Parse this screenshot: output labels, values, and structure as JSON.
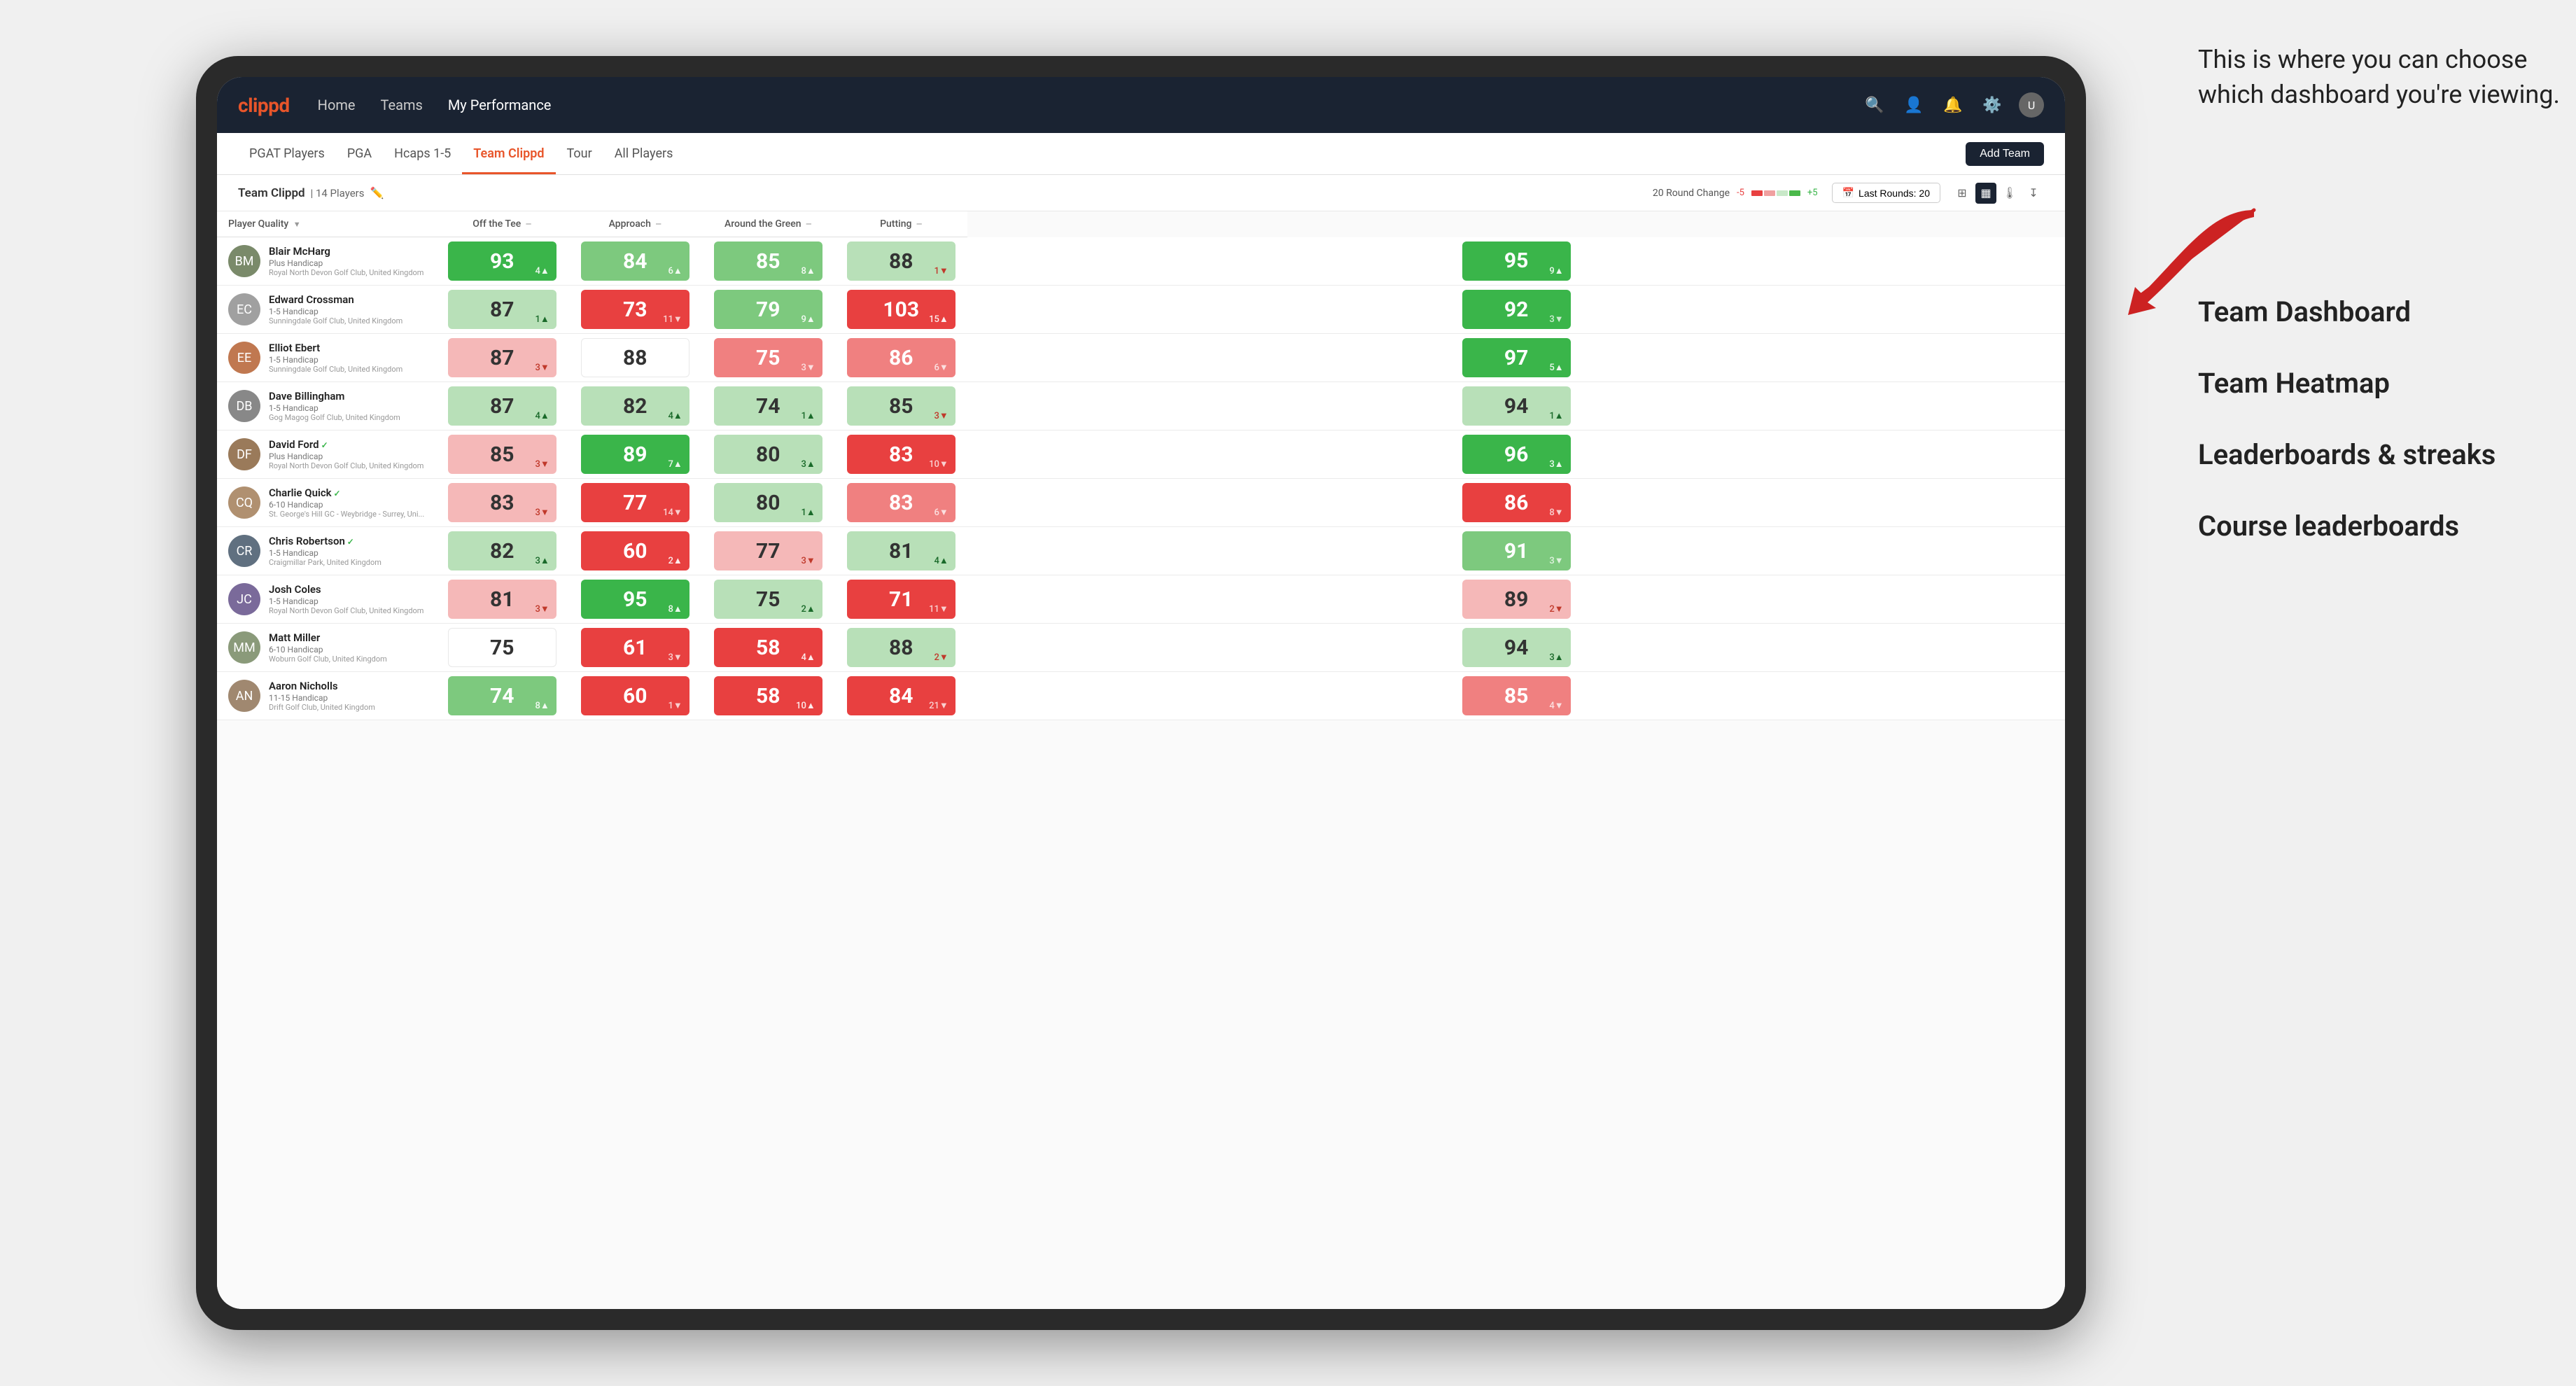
{
  "annotation": {
    "intro_text": "This is where you can choose which dashboard you're viewing.",
    "items": [
      "Team Dashboard",
      "Team Heatmap",
      "Leaderboards & streaks",
      "Course leaderboards"
    ]
  },
  "nav": {
    "logo": "clippd",
    "links": [
      "Home",
      "Teams",
      "My Performance"
    ],
    "active_link": "My Performance"
  },
  "tabs": {
    "items": [
      "PGAT Players",
      "PGA",
      "Hcaps 1-5",
      "Team Clippd",
      "Tour",
      "All Players"
    ],
    "active": "Team Clippd",
    "add_button": "Add Team"
  },
  "sub_header": {
    "team_name": "Team Clippd",
    "separator": "|",
    "player_count": "14 Players",
    "round_change_label": "20 Round Change",
    "change_neg": "-5",
    "change_pos": "+5",
    "last_rounds_label": "Last Rounds:",
    "last_rounds_val": "20"
  },
  "table": {
    "columns": [
      {
        "id": "player",
        "label": "Player Quality",
        "sort": true
      },
      {
        "id": "off_tee",
        "label": "Off the Tee",
        "sort": false
      },
      {
        "id": "approach",
        "label": "Approach",
        "sort": false
      },
      {
        "id": "around_green",
        "label": "Around the Green",
        "sort": false
      },
      {
        "id": "putting",
        "label": "Putting",
        "sort": false
      }
    ],
    "rows": [
      {
        "name": "Blair McHarg",
        "handicap": "Plus Handicap",
        "club": "Royal North Devon Golf Club, United Kingdom",
        "avatar_color": "#7a8a6a",
        "avatar_initials": "BM",
        "player_quality": {
          "val": 93,
          "change": 4,
          "dir": "up",
          "bg": "bg-green-dark"
        },
        "off_tee": {
          "val": 84,
          "change": 6,
          "dir": "up",
          "bg": "bg-green-med"
        },
        "approach": {
          "val": 85,
          "change": 8,
          "dir": "up",
          "bg": "bg-green-med"
        },
        "around_green": {
          "val": 88,
          "change": 1,
          "dir": "down",
          "bg": "bg-green-light"
        },
        "putting": {
          "val": 95,
          "change": 9,
          "dir": "up",
          "bg": "bg-green-dark"
        }
      },
      {
        "name": "Edward Crossman",
        "handicap": "1-5 Handicap",
        "club": "Sunningdale Golf Club, United Kingdom",
        "avatar_color": "#a0a0a0",
        "avatar_initials": "EC",
        "player_quality": {
          "val": 87,
          "change": 1,
          "dir": "up",
          "bg": "bg-green-light"
        },
        "off_tee": {
          "val": 73,
          "change": 11,
          "dir": "down",
          "bg": "bg-red-dark"
        },
        "approach": {
          "val": 79,
          "change": 9,
          "dir": "up",
          "bg": "bg-green-med"
        },
        "around_green": {
          "val": 103,
          "change": 15,
          "dir": "up",
          "bg": "bg-red-dark"
        },
        "putting": {
          "val": 92,
          "change": 3,
          "dir": "down",
          "bg": "bg-green-dark"
        }
      },
      {
        "name": "Elliot Ebert",
        "handicap": "1-5 Handicap",
        "club": "Sunningdale Golf Club, United Kingdom",
        "avatar_color": "#c07850",
        "avatar_initials": "EE",
        "player_quality": {
          "val": 87,
          "change": 3,
          "dir": "down",
          "bg": "bg-red-light"
        },
        "off_tee": {
          "val": 88,
          "change": 0,
          "dir": "neutral",
          "bg": "bg-white"
        },
        "approach": {
          "val": 75,
          "change": 3,
          "dir": "down",
          "bg": "bg-red-med"
        },
        "around_green": {
          "val": 86,
          "change": 6,
          "dir": "down",
          "bg": "bg-red-med"
        },
        "putting": {
          "val": 97,
          "change": 5,
          "dir": "up",
          "bg": "bg-green-dark"
        }
      },
      {
        "name": "Dave Billingham",
        "handicap": "1-5 Handicap",
        "club": "Gog Magog Golf Club, United Kingdom",
        "avatar_color": "#888",
        "avatar_initials": "DB",
        "player_quality": {
          "val": 87,
          "change": 4,
          "dir": "up",
          "bg": "bg-green-light"
        },
        "off_tee": {
          "val": 82,
          "change": 4,
          "dir": "up",
          "bg": "bg-green-light"
        },
        "approach": {
          "val": 74,
          "change": 1,
          "dir": "up",
          "bg": "bg-green-light"
        },
        "around_green": {
          "val": 85,
          "change": 3,
          "dir": "down",
          "bg": "bg-green-light"
        },
        "putting": {
          "val": 94,
          "change": 1,
          "dir": "up",
          "bg": "bg-green-light"
        }
      },
      {
        "name": "David Ford",
        "handicap": "Plus Handicap",
        "club": "Royal North Devon Golf Club, United Kingdom",
        "avatar_color": "#9a7a5a",
        "avatar_initials": "DF",
        "verified": true,
        "player_quality": {
          "val": 85,
          "change": 3,
          "dir": "down",
          "bg": "bg-red-light"
        },
        "off_tee": {
          "val": 89,
          "change": 7,
          "dir": "up",
          "bg": "bg-green-dark"
        },
        "approach": {
          "val": 80,
          "change": 3,
          "dir": "up",
          "bg": "bg-green-light"
        },
        "around_green": {
          "val": 83,
          "change": 10,
          "dir": "down",
          "bg": "bg-red-dark"
        },
        "putting": {
          "val": 96,
          "change": 3,
          "dir": "up",
          "bg": "bg-green-dark"
        }
      },
      {
        "name": "Charlie Quick",
        "handicap": "6-10 Handicap",
        "club": "St. George's Hill GC - Weybridge - Surrey, Uni...",
        "avatar_color": "#b09070",
        "avatar_initials": "CQ",
        "verified": true,
        "player_quality": {
          "val": 83,
          "change": 3,
          "dir": "down",
          "bg": "bg-red-light"
        },
        "off_tee": {
          "val": 77,
          "change": 14,
          "dir": "down",
          "bg": "bg-red-dark"
        },
        "approach": {
          "val": 80,
          "change": 1,
          "dir": "up",
          "bg": "bg-green-light"
        },
        "around_green": {
          "val": 83,
          "change": 6,
          "dir": "down",
          "bg": "bg-red-med"
        },
        "putting": {
          "val": 86,
          "change": 8,
          "dir": "down",
          "bg": "bg-red-dark"
        }
      },
      {
        "name": "Chris Robertson",
        "handicap": "1-5 Handicap",
        "club": "Craigmillar Park, United Kingdom",
        "avatar_color": "#607080",
        "avatar_initials": "CR",
        "verified": true,
        "player_quality": {
          "val": 82,
          "change": 3,
          "dir": "up",
          "bg": "bg-green-light"
        },
        "off_tee": {
          "val": 60,
          "change": 2,
          "dir": "up",
          "bg": "bg-red-dark"
        },
        "approach": {
          "val": 77,
          "change": 3,
          "dir": "down",
          "bg": "bg-red-light"
        },
        "around_green": {
          "val": 81,
          "change": 4,
          "dir": "up",
          "bg": "bg-green-light"
        },
        "putting": {
          "val": 91,
          "change": 3,
          "dir": "down",
          "bg": "bg-green-med"
        }
      },
      {
        "name": "Josh Coles",
        "handicap": "1-5 Handicap",
        "club": "Royal North Devon Golf Club, United Kingdom",
        "avatar_color": "#7a6a9a",
        "avatar_initials": "JC",
        "player_quality": {
          "val": 81,
          "change": 3,
          "dir": "down",
          "bg": "bg-red-light"
        },
        "off_tee": {
          "val": 95,
          "change": 8,
          "dir": "up",
          "bg": "bg-green-dark"
        },
        "approach": {
          "val": 75,
          "change": 2,
          "dir": "up",
          "bg": "bg-green-light"
        },
        "around_green": {
          "val": 71,
          "change": 11,
          "dir": "down",
          "bg": "bg-red-dark"
        },
        "putting": {
          "val": 89,
          "change": 2,
          "dir": "down",
          "bg": "bg-red-light"
        }
      },
      {
        "name": "Matt Miller",
        "handicap": "6-10 Handicap",
        "club": "Woburn Golf Club, United Kingdom",
        "avatar_color": "#8a9a7a",
        "avatar_initials": "MM",
        "player_quality": {
          "val": 75,
          "change": 0,
          "dir": "neutral",
          "bg": "bg-white"
        },
        "off_tee": {
          "val": 61,
          "change": 3,
          "dir": "down",
          "bg": "bg-red-dark"
        },
        "approach": {
          "val": 58,
          "change": 4,
          "dir": "up",
          "bg": "bg-red-dark"
        },
        "around_green": {
          "val": 88,
          "change": 2,
          "dir": "down",
          "bg": "bg-green-light"
        },
        "putting": {
          "val": 94,
          "change": 3,
          "dir": "up",
          "bg": "bg-green-light"
        }
      },
      {
        "name": "Aaron Nicholls",
        "handicap": "11-15 Handicap",
        "club": "Drift Golf Club, United Kingdom",
        "avatar_color": "#a08870",
        "avatar_initials": "AN",
        "player_quality": {
          "val": 74,
          "change": 8,
          "dir": "up",
          "bg": "bg-green-med"
        },
        "off_tee": {
          "val": 60,
          "change": 1,
          "dir": "down",
          "bg": "bg-red-dark"
        },
        "approach": {
          "val": 58,
          "change": 10,
          "dir": "up",
          "bg": "bg-red-dark"
        },
        "around_green": {
          "val": 84,
          "change": 21,
          "dir": "down",
          "bg": "bg-red-dark"
        },
        "putting": {
          "val": 85,
          "change": 4,
          "dir": "down",
          "bg": "bg-red-med"
        }
      }
    ]
  }
}
